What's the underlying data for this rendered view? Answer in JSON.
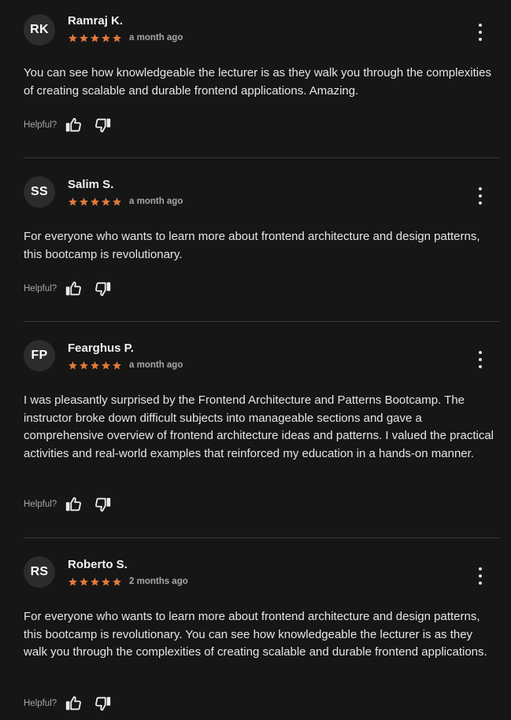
{
  "helpful_label": "Helpful?",
  "colors": {
    "background": "#161616",
    "star": "#e07a3a",
    "avatar_bg": "#2c2c2c",
    "divider": "#3a3a3a"
  },
  "reviews": [
    {
      "initials": "RK",
      "name": "Ramraj K.",
      "rating": 5,
      "date": "a month ago",
      "text": "You can see how knowledgeable the lecturer is as they walk you through the complexities of creating scalable and durable frontend applications. Amazing."
    },
    {
      "initials": "SS",
      "name": "Salim S.",
      "rating": 5,
      "date": "a month ago",
      "text": "For everyone who wants to learn more about frontend architecture and design patterns, this bootcamp is revolutionary."
    },
    {
      "initials": "FP",
      "name": "Fearghus P.",
      "rating": 5,
      "date": "a month ago",
      "text": "I was pleasantly surprised by the Frontend Architecture and Patterns Bootcamp. The instructor broke down difficult subjects into manageable sections and gave a comprehensive overview of frontend architecture ideas and patterns. I valued the practical activities and real-world examples that reinforced my education in a hands-on manner."
    },
    {
      "initials": "RS",
      "name": "Roberto S.",
      "rating": 5,
      "date": "2 months ago",
      "text": "For everyone who wants to learn more about frontend architecture and design patterns, this bootcamp is revolutionary. You can see how knowledgeable the lecturer is as they walk you through the complexities of creating scalable and durable frontend applications."
    }
  ]
}
